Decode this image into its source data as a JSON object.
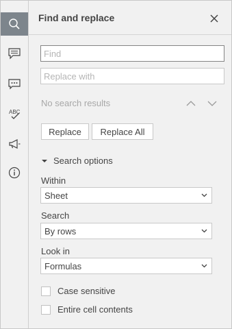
{
  "rail": {
    "items": [
      {
        "icon": "search-icon",
        "active": true
      },
      {
        "icon": "comment-icon",
        "active": false
      },
      {
        "icon": "chat-icon",
        "active": false
      },
      {
        "icon": "spellcheck-icon",
        "active": false
      },
      {
        "icon": "megaphone-icon",
        "active": false
      },
      {
        "icon": "info-icon",
        "active": false
      }
    ]
  },
  "panel": {
    "title": "Find and replace",
    "find_placeholder": "Find",
    "find_value": "",
    "replace_placeholder": "Replace with",
    "replace_value": "",
    "status": "No search results",
    "replace_label": "Replace",
    "replace_all_label": "Replace All",
    "options_label": "Search options",
    "within_label": "Within",
    "within_value": "Sheet",
    "search_label": "Search",
    "search_value": "By rows",
    "lookin_label": "Look in",
    "lookin_value": "Formulas",
    "case_label": "Case sensitive",
    "case_checked": false,
    "entire_label": "Entire cell contents",
    "entire_checked": false
  },
  "colors": {
    "active_rail": "#7d858c",
    "panel_bg": "#f1f1f1",
    "text": "#444444",
    "muted": "#a8a8a8"
  }
}
